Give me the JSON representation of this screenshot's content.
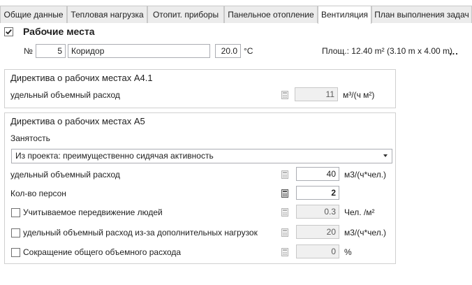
{
  "tabs": [
    {
      "label": "Общие данные",
      "active": false
    },
    {
      "label": "Тепловая нагрузка",
      "active": false
    },
    {
      "label": "Отопит. приборы",
      "active": false
    },
    {
      "label": "Панельное отопление",
      "active": false
    },
    {
      "label": "Вентиляция",
      "active": true
    },
    {
      "label": "План выполнения задач",
      "active": false
    }
  ],
  "workplaces": {
    "checked": true,
    "title": "Рабочие места"
  },
  "room": {
    "number_label": "№",
    "number": "5",
    "name": "Коридор",
    "temperature": "20.0",
    "temperature_unit": "°C",
    "area": "Площ.: 12.40  m² (3.10 m x 4.00 m)",
    "more": "..."
  },
  "directive_a41": {
    "title": "Директива о рабочих местах А4.1",
    "specific_flow_label": "удельный объемный расход",
    "specific_flow_value": "11",
    "specific_flow_unit": "м³/(ч м²)"
  },
  "directive_a5": {
    "title": "Директива о рабочих местах А5",
    "occupancy_label": "Занятость",
    "occupancy_value": "Из проекта: преимущественно сидячая активность",
    "specific_flow_label": "удельный объемный расход",
    "specific_flow_value": "40",
    "specific_flow_unit": "м3/(ч*чел.)",
    "persons_label": "Кол-во персон",
    "persons_value": "2",
    "movement": {
      "checked": false,
      "label": "Учитываемое передвижение людей",
      "value": "0.3",
      "unit": "Чел. /м²"
    },
    "additional_loads": {
      "checked": false,
      "label": "удельный объемный расход из-за дополнительных нагрузок",
      "value": "20",
      "unit": "м3/(ч*чел.)"
    },
    "reduction": {
      "checked": false,
      "label": "Сокращение общего объемного расхода",
      "value": "0",
      "unit": "%"
    }
  }
}
